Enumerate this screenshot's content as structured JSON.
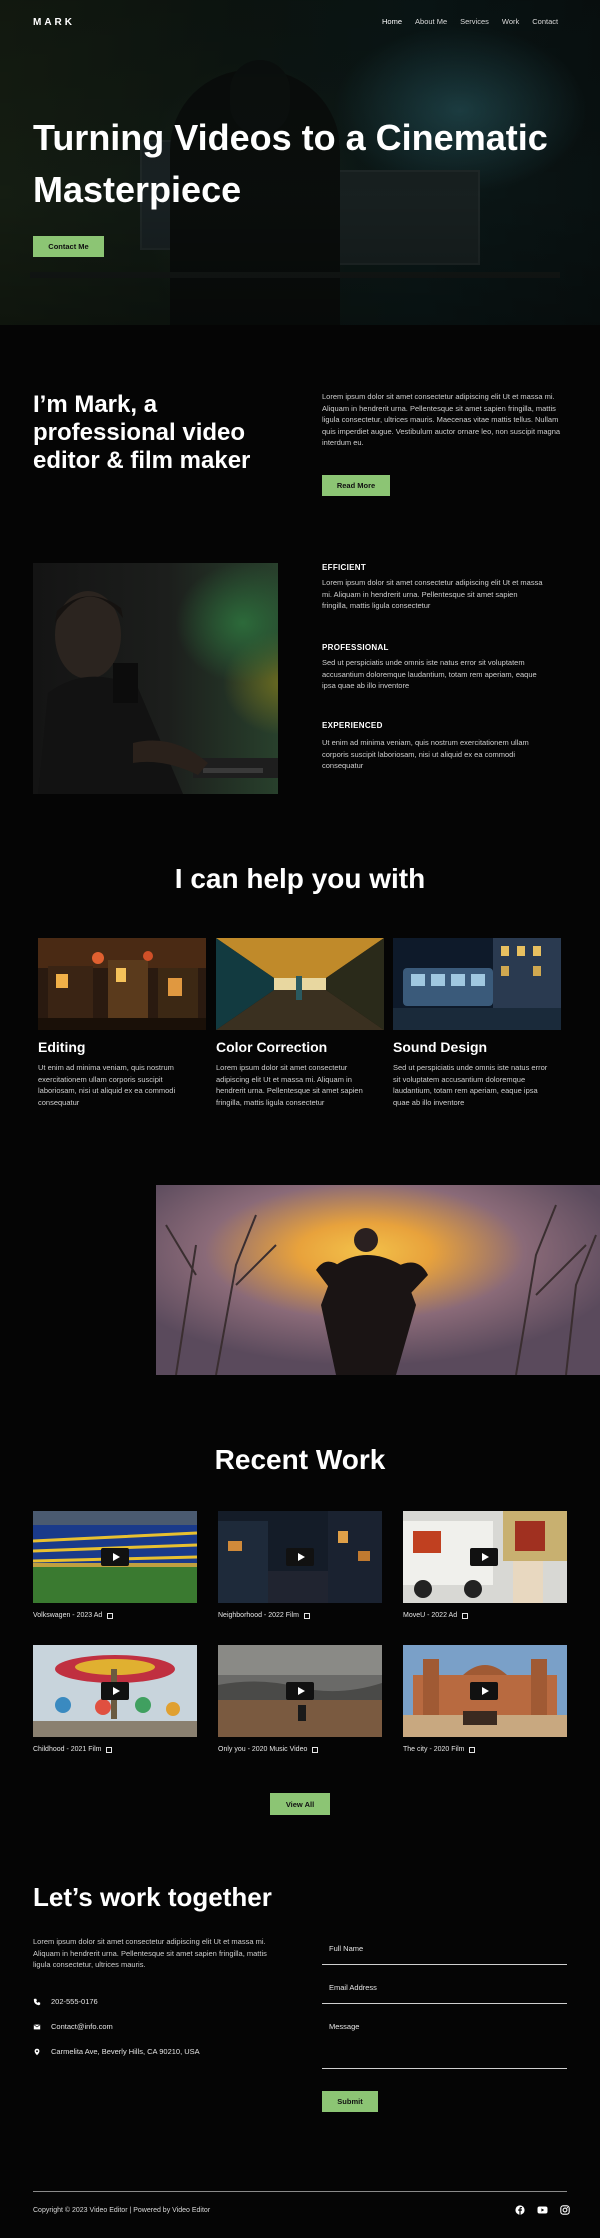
{
  "header": {
    "logo": "MARK",
    "nav": [
      "Home",
      "About Me",
      "Services",
      "Work",
      "Contact"
    ]
  },
  "hero": {
    "title": "Turning Videos to a Cinematic Masterpiece",
    "button": "Contact Me"
  },
  "about": {
    "title": "I’m Mark, a professional video editor & film maker",
    "text": "Lorem ipsum dolor sit amet consectetur adipiscing elit Ut et massa mi. Aliquam in hendrerit urna. Pellentesque sit amet sapien fringilla, mattis ligula consectetur, ultrices mauris. Maecenas vitae mattis tellus. Nullam quis imperdiet augue. Vestibulum auctor ornare leo, non suscipit magna interdum eu.",
    "button": "Read More",
    "features": [
      {
        "title": "EFFICIENT",
        "text": "Lorem ipsum dolor sit amet consectetur adipiscing elit Ut et massa mi. Aliquam in hendrerit urna. Pellentesque sit amet sapien fringilla, mattis ligula consectetur"
      },
      {
        "title": "PROFESSIONAL",
        "text": "Sed ut perspiciatis unde omnis iste natus error sit voluptatem accusantium doloremque laudantium, totam rem aperiam, eaque ipsa quae ab illo inventore"
      },
      {
        "title": "EXPERIENCED",
        "text": "Ut enim ad minima veniam, quis nostrum exercitationem ullam corporis suscipit laboriosam, nisi ut aliquid ex ea commodi consequatur"
      }
    ]
  },
  "services": {
    "title": "I can help you with",
    "items": [
      {
        "title": "Editing",
        "text": "Ut enim ad minima veniam, quis nostrum exercitationem ullam corporis suscipit laboriosam, nisi ut aliquid ex ea commodi consequatur"
      },
      {
        "title": "Color Correction",
        "text": "Lorem ipsum dolor sit amet consectetur adipiscing elit Ut et massa mi. Aliquam in hendrerit urna. Pellentesque sit amet sapien fringilla, mattis ligula consectetur"
      },
      {
        "title": "Sound Design",
        "text": "Sed ut perspiciatis unde omnis iste natus error sit voluptatem accusantium doloremque laudantium, totam rem aperiam, eaque ipsa quae ab illo inventore"
      }
    ]
  },
  "work": {
    "title": "Recent Work",
    "items": [
      {
        "caption": "Volkswagen - 2023 Ad"
      },
      {
        "caption": "Neighborhood - 2022 Film"
      },
      {
        "caption": "MoveU - 2022 Ad"
      },
      {
        "caption": "Childhood - 2021 Film"
      },
      {
        "caption": "Only you - 2020 Music Video"
      },
      {
        "caption": "The city - 2020 Film"
      }
    ],
    "button": "View All"
  },
  "contact": {
    "title": "Let’s work together",
    "text": "Lorem ipsum dolor sit amet consectetur adipiscing elit Ut et massa mi. Aliquam in hendrerit urna. Pellentesque sit amet sapien fringilla, mattis ligula consectetur, ultrices mauris.",
    "phone": "202-555-0176",
    "email": "Contact@info.com",
    "address": "Carmelita Ave, Beverly Hills, CA 90210, USA",
    "fields": {
      "name": "Full Name",
      "email": "Email Address",
      "message": "Message"
    },
    "submit": "Submit"
  },
  "footer": {
    "copyright": "Copyright © 2023 Video Editor | Powered by Video Editor",
    "social": [
      "facebook-icon",
      "youtube-icon",
      "instagram-icon"
    ]
  },
  "colors": {
    "accent": "#8cc574",
    "background": "#050505"
  }
}
